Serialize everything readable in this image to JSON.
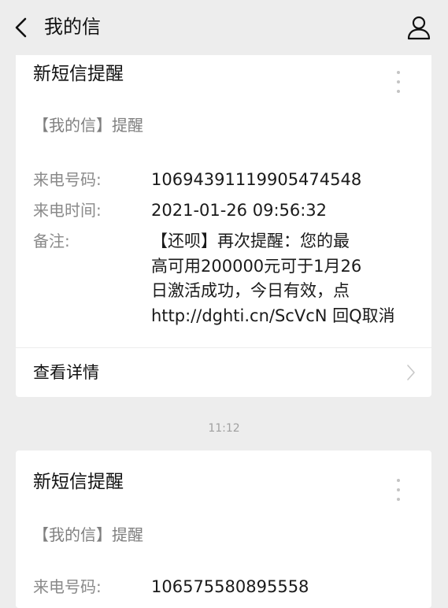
{
  "header": {
    "title": "我的信",
    "back_icon": "chevron-left-icon",
    "profile_icon": "user-icon"
  },
  "messages": [
    {
      "title": "新短信提醒",
      "subtitle": "【我的信】提醒",
      "fields": [
        {
          "label": "来电号码:",
          "value": "10694391119905474548"
        },
        {
          "label": "来电时间:",
          "value": "2021-01-26 09:56:32"
        },
        {
          "label": "备注:",
          "value": "【还呗】再次提醒：您的最\n高可用200000元可于1月26\n日激活成功，今日有效，点\nhttp://dghti.cn/ScVcN 回Q取消"
        }
      ],
      "detail_label": "查看详情"
    },
    {
      "timestamp": "11:12",
      "title": "新短信提醒",
      "subtitle": "【我的信】提醒",
      "fields": [
        {
          "label": "来电号码:",
          "value": "106575580895558"
        }
      ]
    }
  ],
  "colors": {
    "background": "#ededed",
    "card": "#ffffff",
    "muted_text": "#8a8a8a",
    "subtitle_text": "#7f7f7f"
  }
}
